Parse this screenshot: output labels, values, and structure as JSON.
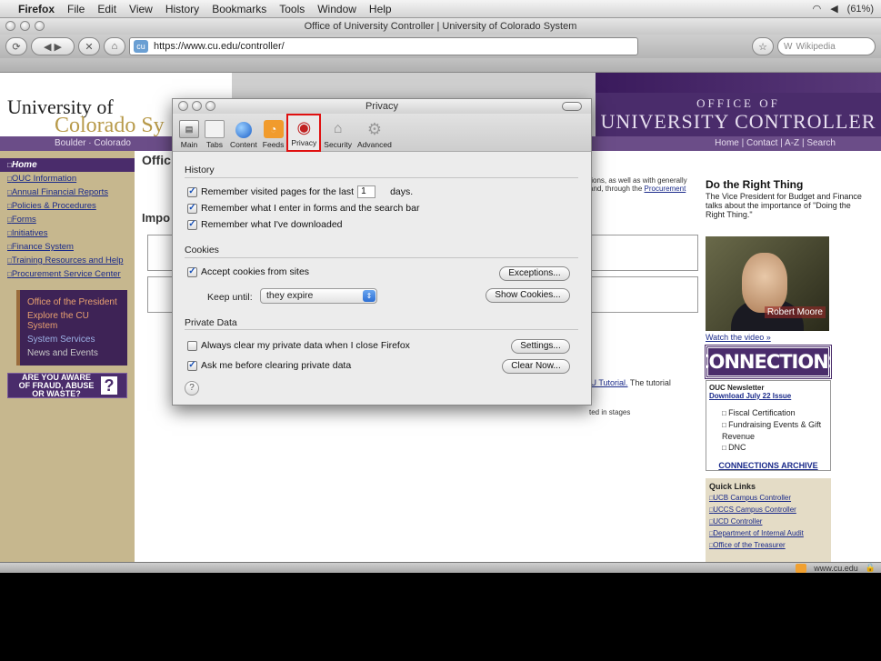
{
  "menubar": {
    "app": "Firefox",
    "items": [
      "File",
      "Edit",
      "View",
      "History",
      "Bookmarks",
      "Tools",
      "Window",
      "Help"
    ],
    "battery": "(61%)"
  },
  "window": {
    "title": "Office of University Controller | University of Colorado System"
  },
  "toolbar": {
    "url": "https://www.cu.edu/controller/",
    "search_placeholder": "Wikipedia"
  },
  "page": {
    "logo_line1": "University of",
    "logo_line2": "Colorado Sy",
    "office_of": "OFFICE OF",
    "controller": "UNIVERSITY CONTROLLER",
    "nav_left": "Boulder · Colorado",
    "nav_right": "Home | Contact | A-Z | Search",
    "sidebar_home": "Home",
    "sidebar_links": [
      "OUC Information",
      "Annual Financial Reports",
      "Policies & Procedures",
      "Forms",
      "Initiatives",
      "Finance System",
      "Training Resources and Help",
      "Procurement Service Center"
    ],
    "sidebar_box": [
      "Office of the President",
      "Explore the CU System",
      "System Services",
      "News and Events"
    ],
    "fraud_text": "ARE YOU AWARE OF FRAUD, ABUSE OR WASTE?",
    "fraud_q": "?",
    "main_heading": "Offic",
    "important_heading": "Impo",
    "right_text": "tions, as well as with generally and, through the ",
    "procurement_link": "Procurement",
    "tutorial_link": "CU Tutorial.",
    "tutorial_rest": " The tutorial",
    "stages_text": "ted in stages",
    "dtr_title": "Do the Right Thing",
    "dtr_body": "The Vice President for Budget and Finance talks about the importance of \"Doing the Right Thing.\"",
    "video_caption": "Robert Moore",
    "watch_link": "Watch the video »",
    "connections": "CONNECTIONS",
    "ouc_newsletter": "OUC Newsletter",
    "download_link": "Download July 22 Issue",
    "conn_items": [
      "Fiscal Certification",
      "Fundraising Events & Gift Revenue",
      "DNC"
    ],
    "conn_archive": "CONNECTIONS ARCHIVE",
    "quick_links_title": "Quick Links",
    "quick_links": [
      "UCB Campus Controller",
      "UCCS Campus Controller",
      "UCD Controller",
      "Department of Internal Audit",
      "Office of the Treasurer"
    ]
  },
  "statusbar": {
    "domain": "www.cu.edu"
  },
  "dialog": {
    "title": "Privacy",
    "tabs": [
      {
        "label": "Main",
        "icon": "main-icon"
      },
      {
        "label": "Tabs",
        "icon": "tabs-icon"
      },
      {
        "label": "Content",
        "icon": "globe-icon"
      },
      {
        "label": "Feeds",
        "icon": "feed-icon"
      },
      {
        "label": "Privacy",
        "icon": "privacy-mask-icon",
        "selected": true
      },
      {
        "label": "Security",
        "icon": "lock-icon"
      },
      {
        "label": "Advanced",
        "icon": "gear-icon"
      }
    ],
    "history_heading": "History",
    "remember_pages_label": "Remember visited pages for the last",
    "remember_pages_days": "1",
    "days_label": "days.",
    "remember_forms_label": "Remember what I enter in forms and the search bar",
    "remember_downloads_label": "Remember what I've downloaded",
    "cookies_heading": "Cookies",
    "accept_cookies_label": "Accept cookies from sites",
    "exceptions_button": "Exceptions...",
    "keep_until_label": "Keep until:",
    "keep_until_value": "they expire",
    "show_cookies_button": "Show Cookies...",
    "private_data_heading": "Private Data",
    "always_clear_label": "Always clear my private data when I close Firefox",
    "settings_button": "Settings...",
    "ask_before_label": "Ask me before clearing private data",
    "clear_now_button": "Clear Now...",
    "help_glyph": "?"
  }
}
